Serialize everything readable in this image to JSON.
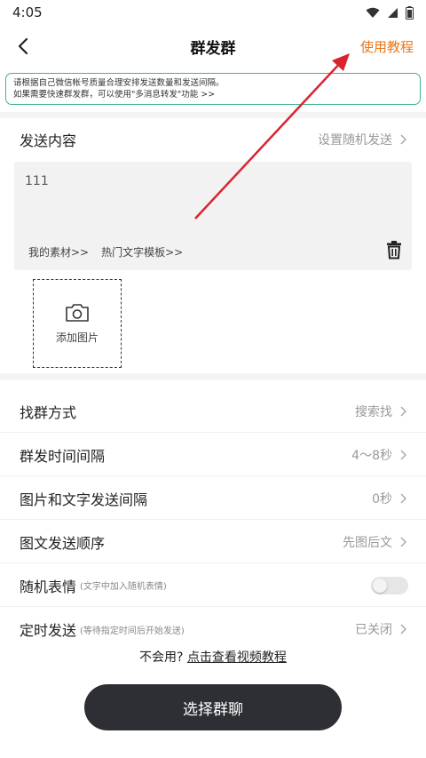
{
  "status_bar": {
    "time": "4:05",
    "icons": [
      "wifi-icon",
      "signal-icon",
      "battery-icon"
    ]
  },
  "nav": {
    "title": "群发群",
    "tutorial": "使用教程",
    "tutorial_color": "#e8761a"
  },
  "tip": {
    "line1": "请根据自己微信帐号质量合理安排发送数量和发送间隔。",
    "line2": "如果需要快速群发群，可以使用\"多消息转发\"功能 >>"
  },
  "send_content": {
    "label": "发送内容",
    "value": "设置随机发送",
    "text": "111",
    "my_materials": "我的素材>>",
    "hot_templates": "热门文字模板>>",
    "add_image": "添加图片"
  },
  "settings": [
    {
      "label": "找群方式",
      "value": "搜索找"
    },
    {
      "label": "群发时间间隔",
      "value": "4～8秒"
    },
    {
      "label": "图片和文字发送间隔",
      "value": "0秒"
    },
    {
      "label": "图文发送顺序",
      "value": "先图后文"
    }
  ],
  "random_emoji": {
    "label": "随机表情",
    "sub": "(文字中加入随机表情)",
    "enabled": false
  },
  "scheduled": {
    "label": "定时发送",
    "sub": "(等待指定时间后开始发送)",
    "value": "已关闭"
  },
  "help": {
    "prefix": "不会用? ",
    "link": "点击查看视频教程"
  },
  "primary_button": "选择群聊",
  "colors": {
    "accent": "#e8761a",
    "tip_border": "#3fb38a",
    "button_bg": "#2e2f34",
    "arrow": "#d9232e"
  }
}
